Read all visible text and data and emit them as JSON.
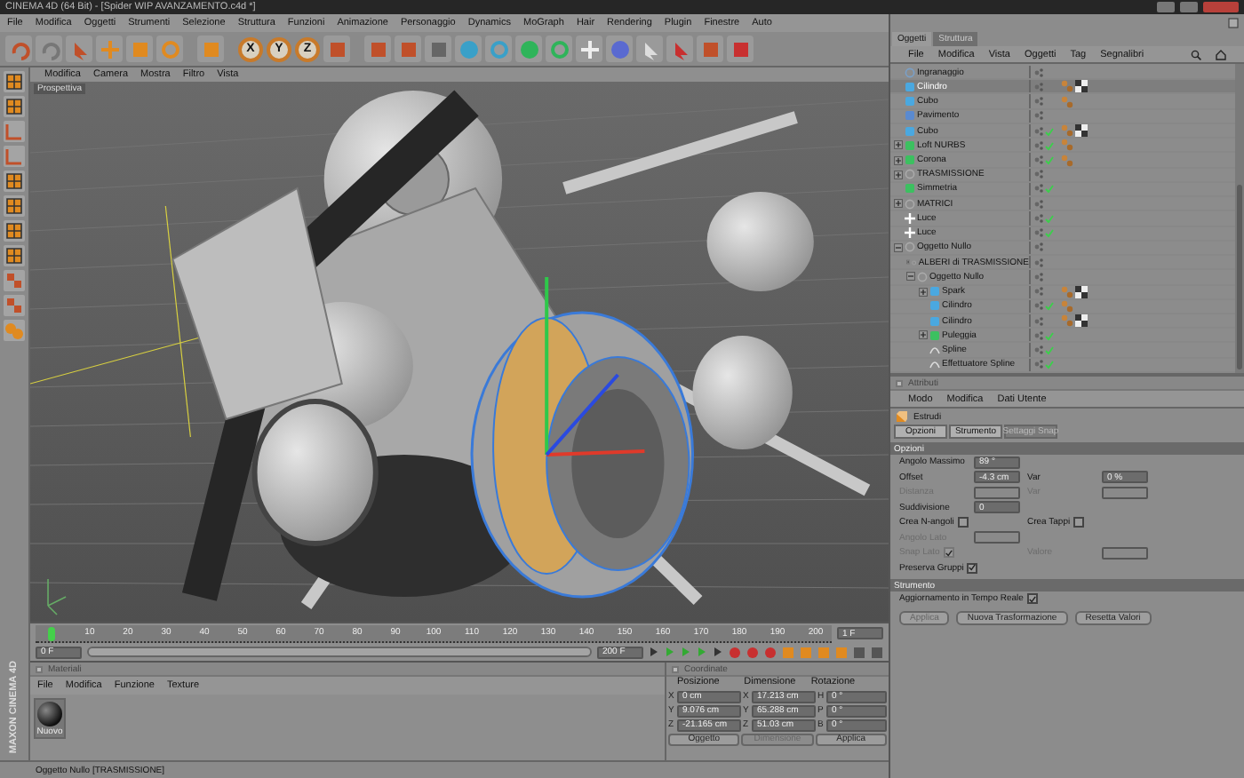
{
  "window": {
    "title": "CINEMA 4D (64 Bit) - [Spider WIP AVANZAMENTO.c4d *]"
  },
  "menu": [
    "File",
    "Modifica",
    "Oggetti",
    "Strumenti",
    "Selezione",
    "Struttura",
    "Funzioni",
    "Animazione",
    "Personaggio",
    "Dynamics",
    "MoGraph",
    "Hair",
    "Rendering",
    "Plugin",
    "Finestre",
    "Auto"
  ],
  "toolbar": {
    "axis_locks": [
      "X",
      "Y",
      "Z"
    ]
  },
  "viewport": {
    "menu": [
      "Modifica",
      "Camera",
      "Mostra",
      "Filtro",
      "Vista"
    ],
    "label": "Prospettiva"
  },
  "timeline": {
    "ruler_labels": [
      "10",
      "20",
      "30",
      "40",
      "50",
      "60",
      "70",
      "80",
      "90",
      "100",
      "110",
      "120",
      "130",
      "140",
      "150",
      "160",
      "170",
      "180",
      "190",
      "200"
    ],
    "level": 0,
    "current_field": "1 F",
    "start_field": "0 F",
    "range": {
      "level": 1
    },
    "end_field": "200 F"
  },
  "materials": {
    "title": "Materiali",
    "menu": [
      "File",
      "Modifica",
      "Funzione",
      "Texture"
    ],
    "items": [
      {
        "name": "Nuovo"
      }
    ]
  },
  "coordinates": {
    "title": "Coordinate",
    "columns": [
      "Posizione",
      "Dimensione",
      "Rotazione"
    ],
    "rows": [
      {
        "axis": "X",
        "position": "0 cm",
        "size_axis": "X",
        "size": "17.213 cm",
        "rot_axis": "H",
        "rotation": "0 °"
      },
      {
        "axis": "Y",
        "position": "9.076 cm",
        "size_axis": "Y",
        "size": "65.288 cm",
        "rot_axis": "P",
        "rotation": "0 °"
      },
      {
        "axis": "Z",
        "position": "-21.165 cm",
        "size_axis": "Z",
        "size": "51.03 cm",
        "rot_axis": "B",
        "rotation": "0 °"
      }
    ],
    "mode": "Oggetto",
    "size_mode": "Dimensione",
    "apply": "Applica"
  },
  "status_bar": "Oggetto Nullo [TRASMISSIONE]",
  "logo": [
    "MAXON",
    "CINEMA 4D"
  ],
  "objects": {
    "tabs": [
      {
        "label": "Oggetti",
        "selected": true
      },
      {
        "label": "Struttura",
        "selected": false
      }
    ],
    "menu": [
      "File",
      "Modifica",
      "Vista",
      "Oggetti",
      "Tag",
      "Segnalibri"
    ],
    "tree": [
      {
        "name": "Ingranaggio",
        "kind": "gear",
        "selected": false,
        "enabled": false
      },
      {
        "name": "Cilindro",
        "kind": "cylinder",
        "selected": true,
        "enabled": false,
        "tags": [
          {
            "kind": "phong"
          },
          {
            "kind": "texture"
          }
        ]
      },
      {
        "name": "Cubo",
        "kind": "cube",
        "selected": false,
        "enabled": false,
        "tags": [
          {
            "kind": "phong"
          }
        ]
      },
      {
        "name": "Pavimento",
        "kind": "floor",
        "selected": false,
        "enabled": false
      },
      {
        "name": "Cubo",
        "kind": "cylinder",
        "selected": false,
        "enabled": true,
        "tags": [
          {
            "kind": "phong"
          },
          {
            "kind": "texture"
          }
        ]
      },
      {
        "name": "Loft NURBS",
        "kind": "loft",
        "selected": false,
        "enabled": true,
        "expanded": false,
        "tags": [
          {
            "kind": "phong"
          }
        ]
      },
      {
        "name": "Corona",
        "kind": "loft",
        "selected": false,
        "enabled": true,
        "expanded": false,
        "tags": [
          {
            "kind": "phong"
          }
        ]
      },
      {
        "name": "TRASMISSIONE",
        "kind": "null",
        "selected": false,
        "enabled": false,
        "expanded": false
      },
      {
        "name": "Simmetria",
        "kind": "symmetry",
        "selected": false,
        "enabled": true
      },
      {
        "name": "MATRICI",
        "kind": "null",
        "selected": false,
        "enabled": false,
        "expanded": false
      },
      {
        "name": "Luce",
        "kind": "light",
        "selected": false,
        "enabled": true
      },
      {
        "name": "Luce",
        "kind": "light",
        "selected": false,
        "enabled": true
      },
      {
        "name": "Oggetto Nullo",
        "kind": "null",
        "selected": false,
        "enabled": false,
        "expanded": true,
        "children": [
          {
            "name": "ALBERI di TRASMISSIONE",
            "kind": "null",
            "selected": false,
            "enabled": false,
            "expanded": false
          },
          {
            "name": "Oggetto Nullo",
            "kind": "null",
            "selected": false,
            "enabled": false,
            "expanded": true,
            "children": [
              {
                "name": "Spark",
                "kind": "cylinder",
                "selected": false,
                "enabled": false,
                "expanded": false,
                "tags": [
                  {
                    "kind": "phong"
                  },
                  {
                    "kind": "texture"
                  }
                ]
              },
              {
                "name": "Cilindro",
                "kind": "cube",
                "selected": false,
                "enabled": true,
                "tags": [
                  {
                    "kind": "phong"
                  }
                ]
              },
              {
                "name": "Cilindro",
                "kind": "cylinder",
                "selected": false,
                "enabled": false,
                "tags": [
                  {
                    "kind": "phong"
                  },
                  {
                    "kind": "texture"
                  }
                ]
              },
              {
                "name": "Puleggia",
                "kind": "loft",
                "selected": false,
                "enabled": true,
                "expanded": false
              },
              {
                "name": "Spline",
                "kind": "spline",
                "selected": false,
                "enabled": true
              },
              {
                "name": "Effettuatore Spline",
                "kind": "spline",
                "selected": false,
                "enabled": true
              }
            ]
          }
        ]
      }
    ]
  },
  "attributes": {
    "title": "Attributi",
    "menu": [
      "Modo",
      "Modifica",
      "Dati Utente"
    ],
    "tool": "Estrudi",
    "tabs": [
      {
        "label": "Opzioni",
        "selected": true
      },
      {
        "label": "Strumento",
        "selected": true
      },
      {
        "label": "Settaggi Snap",
        "selected": false
      }
    ],
    "sections": [
      {
        "title": "Opzioni",
        "rows": [
          [
            {
              "kind": "number",
              "label": "Angolo Massimo",
              "value": "89 °",
              "disabled": false
            }
          ],
          [
            {
              "kind": "number",
              "label": "Offset",
              "value": "-4.3 cm",
              "disabled": false
            },
            {
              "kind": "number",
              "label": "Var",
              "value": "0 %",
              "disabled": false
            }
          ],
          [
            {
              "kind": "number",
              "label": "Distanza",
              "disabled": true
            },
            {
              "kind": "number",
              "label": "Var",
              "disabled": true
            }
          ],
          [
            {
              "kind": "number",
              "label": "Suddivisione",
              "value": "0",
              "disabled": false
            }
          ],
          [
            {
              "kind": "check",
              "label": "Crea N-angoli",
              "checked": false,
              "disabled": false
            },
            {
              "kind": "check",
              "label": "Crea Tappi",
              "checked": false,
              "disabled": false
            }
          ],
          [
            {
              "kind": "number",
              "label": "Angolo Lato",
              "disabled": true
            }
          ],
          [
            {
              "kind": "check",
              "label": "Snap Lato",
              "checked": true,
              "disabled": true
            },
            {
              "kind": "number",
              "label": "Valore",
              "disabled": true
            }
          ],
          [
            {
              "kind": "check",
              "label": "Preserva Gruppi",
              "checked": true,
              "disabled": false
            }
          ]
        ]
      },
      {
        "title": "Strumento",
        "rows": [
          [
            {
              "kind": "check",
              "label": "Aggiornamento in Tempo Reale",
              "checked": true,
              "disabled": false
            }
          ]
        ]
      }
    ],
    "buttons": [
      "Applica",
      "Nuova Trasformazione",
      "Resetta Valori"
    ]
  }
}
